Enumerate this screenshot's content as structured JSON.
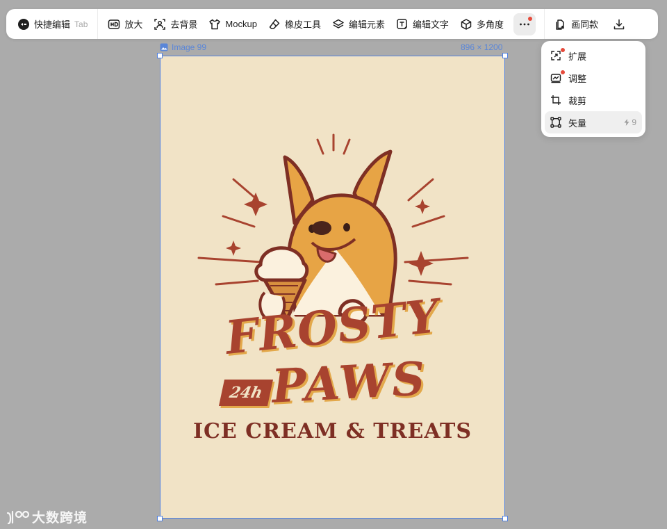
{
  "toolbar": {
    "quick_edit": {
      "label": "快捷编辑",
      "hint": "Tab",
      "icon": "quick-edit-icon"
    },
    "buttons": [
      {
        "label": "放大",
        "icon": "hd-icon"
      },
      {
        "label": "去背景",
        "icon": "remove-background-icon"
      },
      {
        "label": "Mockup",
        "icon": "tshirt-icon"
      },
      {
        "label": "橡皮工具",
        "icon": "eraser-icon"
      },
      {
        "label": "编辑元素",
        "icon": "layers-icon"
      },
      {
        "label": "编辑文字",
        "icon": "text-edit-icon"
      },
      {
        "label": "多角度",
        "icon": "cube-icon"
      }
    ],
    "more_icon": "more-horizontal-icon",
    "same_style": {
      "label": "画同款",
      "icon": "copy-plus-icon"
    },
    "download_icon": "download-icon"
  },
  "canvas": {
    "image_name": "Image 99",
    "dimensions": "896 × 1200"
  },
  "poster": {
    "title_line1": "FROSTY",
    "title_line2": "PAWS",
    "badge": "24h",
    "tagline": "ICE CREAM & TREATS",
    "colors": {
      "background": "#f1e3c6",
      "primary": "#a8432f",
      "accent": "#e3a84a"
    }
  },
  "menu": {
    "items": [
      {
        "label": "扩展",
        "icon": "expand-icon",
        "new": true
      },
      {
        "label": "调整",
        "icon": "adjust-icon",
        "new": true
      },
      {
        "label": "裁剪",
        "icon": "crop-icon",
        "new": false
      },
      {
        "label": "矢量",
        "icon": "vector-icon",
        "new": false,
        "credit": "9"
      }
    ]
  },
  "watermark": {
    "text": "大数跨境"
  }
}
